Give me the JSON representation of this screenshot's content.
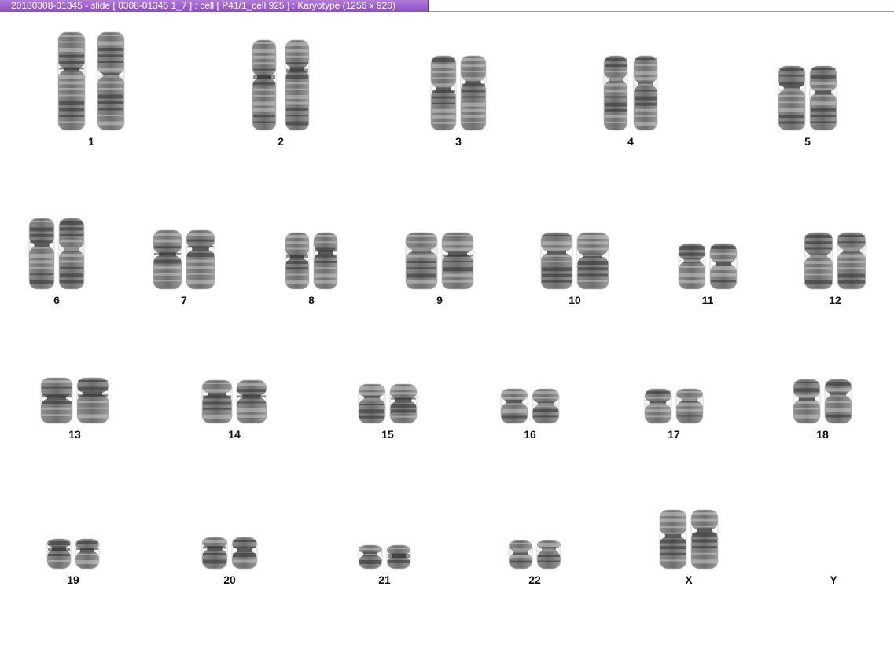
{
  "window": {
    "title": "20180308-01345 - slide [ 0308-01345 1_7 ] : cell [ P41/1_cell 925 ] : Karyotype  (1256 x 920)"
  },
  "karyotype": {
    "chromosomes": [
      {
        "label": "1",
        "count": 2
      },
      {
        "label": "2",
        "count": 2
      },
      {
        "label": "3",
        "count": 2
      },
      {
        "label": "4",
        "count": 2
      },
      {
        "label": "5",
        "count": 2
      },
      {
        "label": "6",
        "count": 2
      },
      {
        "label": "7",
        "count": 2
      },
      {
        "label": "8",
        "count": 2
      },
      {
        "label": "9",
        "count": 2
      },
      {
        "label": "10",
        "count": 2
      },
      {
        "label": "11",
        "count": 2
      },
      {
        "label": "12",
        "count": 2
      },
      {
        "label": "13",
        "count": 2
      },
      {
        "label": "14",
        "count": 2
      },
      {
        "label": "15",
        "count": 2
      },
      {
        "label": "16",
        "count": 2
      },
      {
        "label": "17",
        "count": 2
      },
      {
        "label": "18",
        "count": 2
      },
      {
        "label": "19",
        "count": 2
      },
      {
        "label": "20",
        "count": 2
      },
      {
        "label": "21",
        "count": 2
      },
      {
        "label": "22",
        "count": 2
      },
      {
        "label": "X",
        "count": 2
      },
      {
        "label": "Y",
        "count": 0
      }
    ]
  }
}
